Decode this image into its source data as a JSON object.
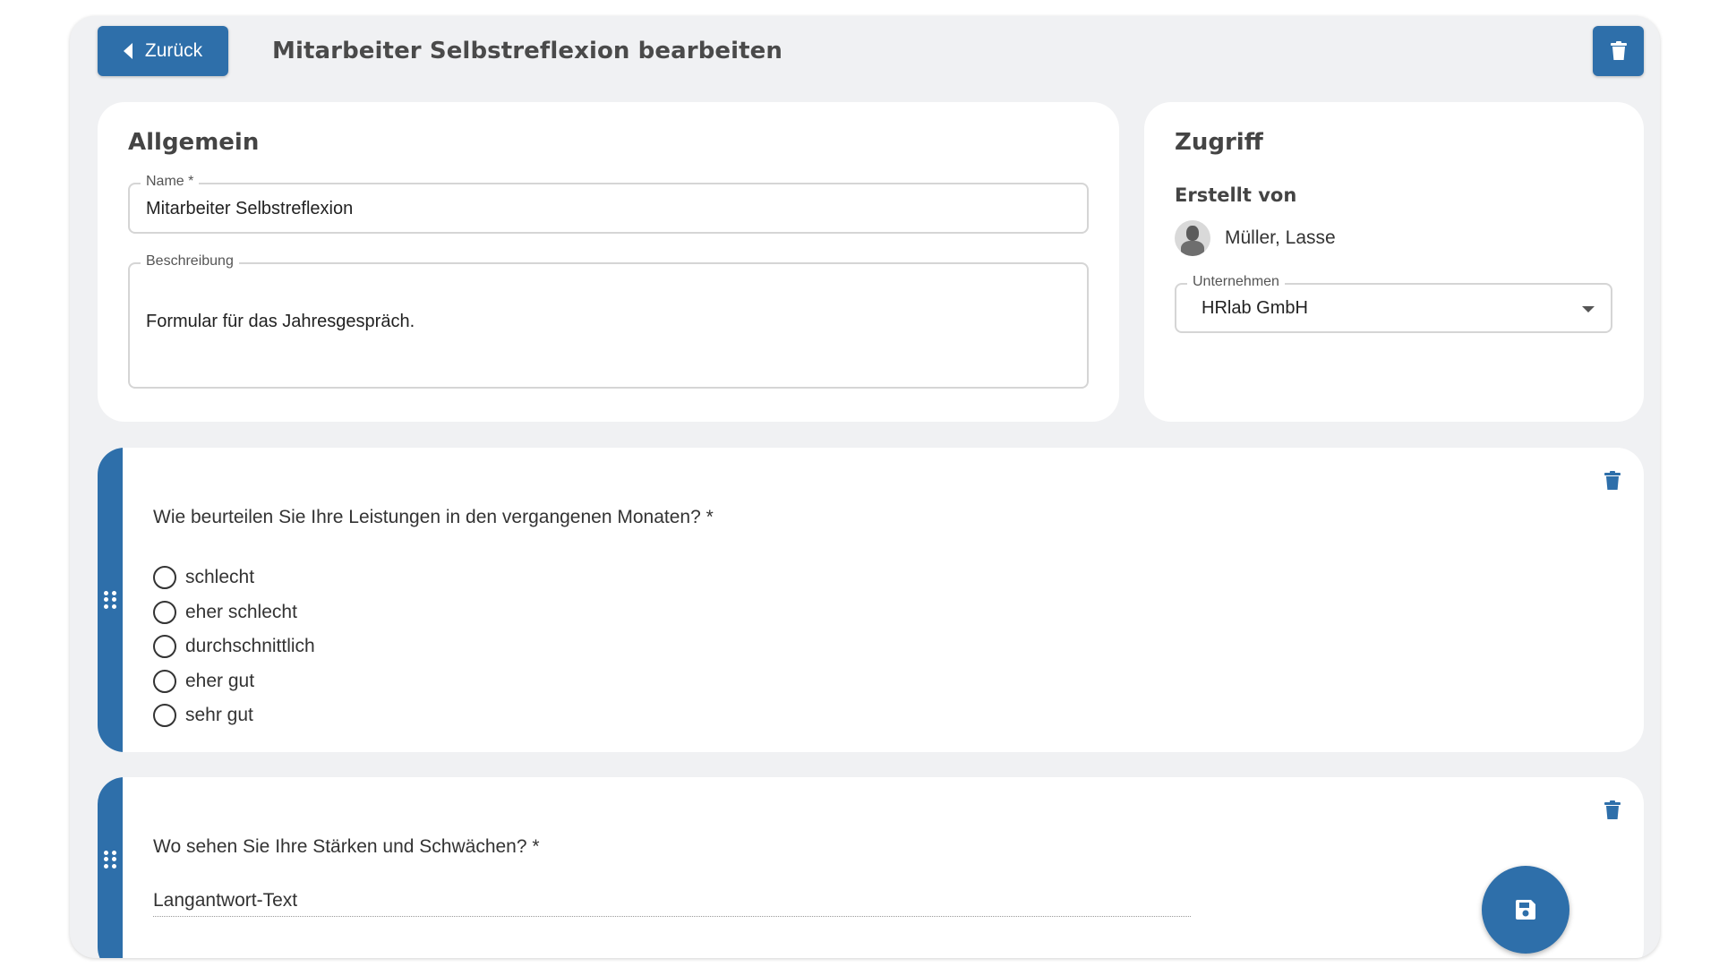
{
  "header": {
    "back_label": "Zurück",
    "title": "Mitarbeiter Selbstreflexion bearbeiten"
  },
  "allgemein": {
    "title": "Allgemein",
    "name_label": "Name *",
    "name_value": "Mitarbeiter Selbstreflexion",
    "description_label": "Beschreibung",
    "description_value": "Formular für das Jahresgespräch."
  },
  "zugriff": {
    "title": "Zugriff",
    "created_by_label": "Erstellt von",
    "creator_name": "Müller, Lasse",
    "company_label": "Unternehmen",
    "company_value": "HRlab GmbH"
  },
  "questions": [
    {
      "text": "Wie beurteilen Sie Ihre Leistungen in den vergangenen Monaten? *",
      "options": [
        "schlecht",
        "eher schlecht",
        "durchschnittlich",
        "eher gut",
        "sehr gut"
      ]
    },
    {
      "text": "Wo sehen Sie Ihre Stärken und Schwächen? *",
      "answer_placeholder": "Langantwort-Text"
    }
  ],
  "icons": {
    "back": "caret-left-icon",
    "delete": "trash-icon",
    "drag": "drag-handle-icon",
    "save": "floppy-disk-icon",
    "dropdown": "caret-down-icon"
  },
  "colors": {
    "accent": "#2e6faa",
    "background": "#f0f1f3",
    "card": "#ffffff"
  }
}
